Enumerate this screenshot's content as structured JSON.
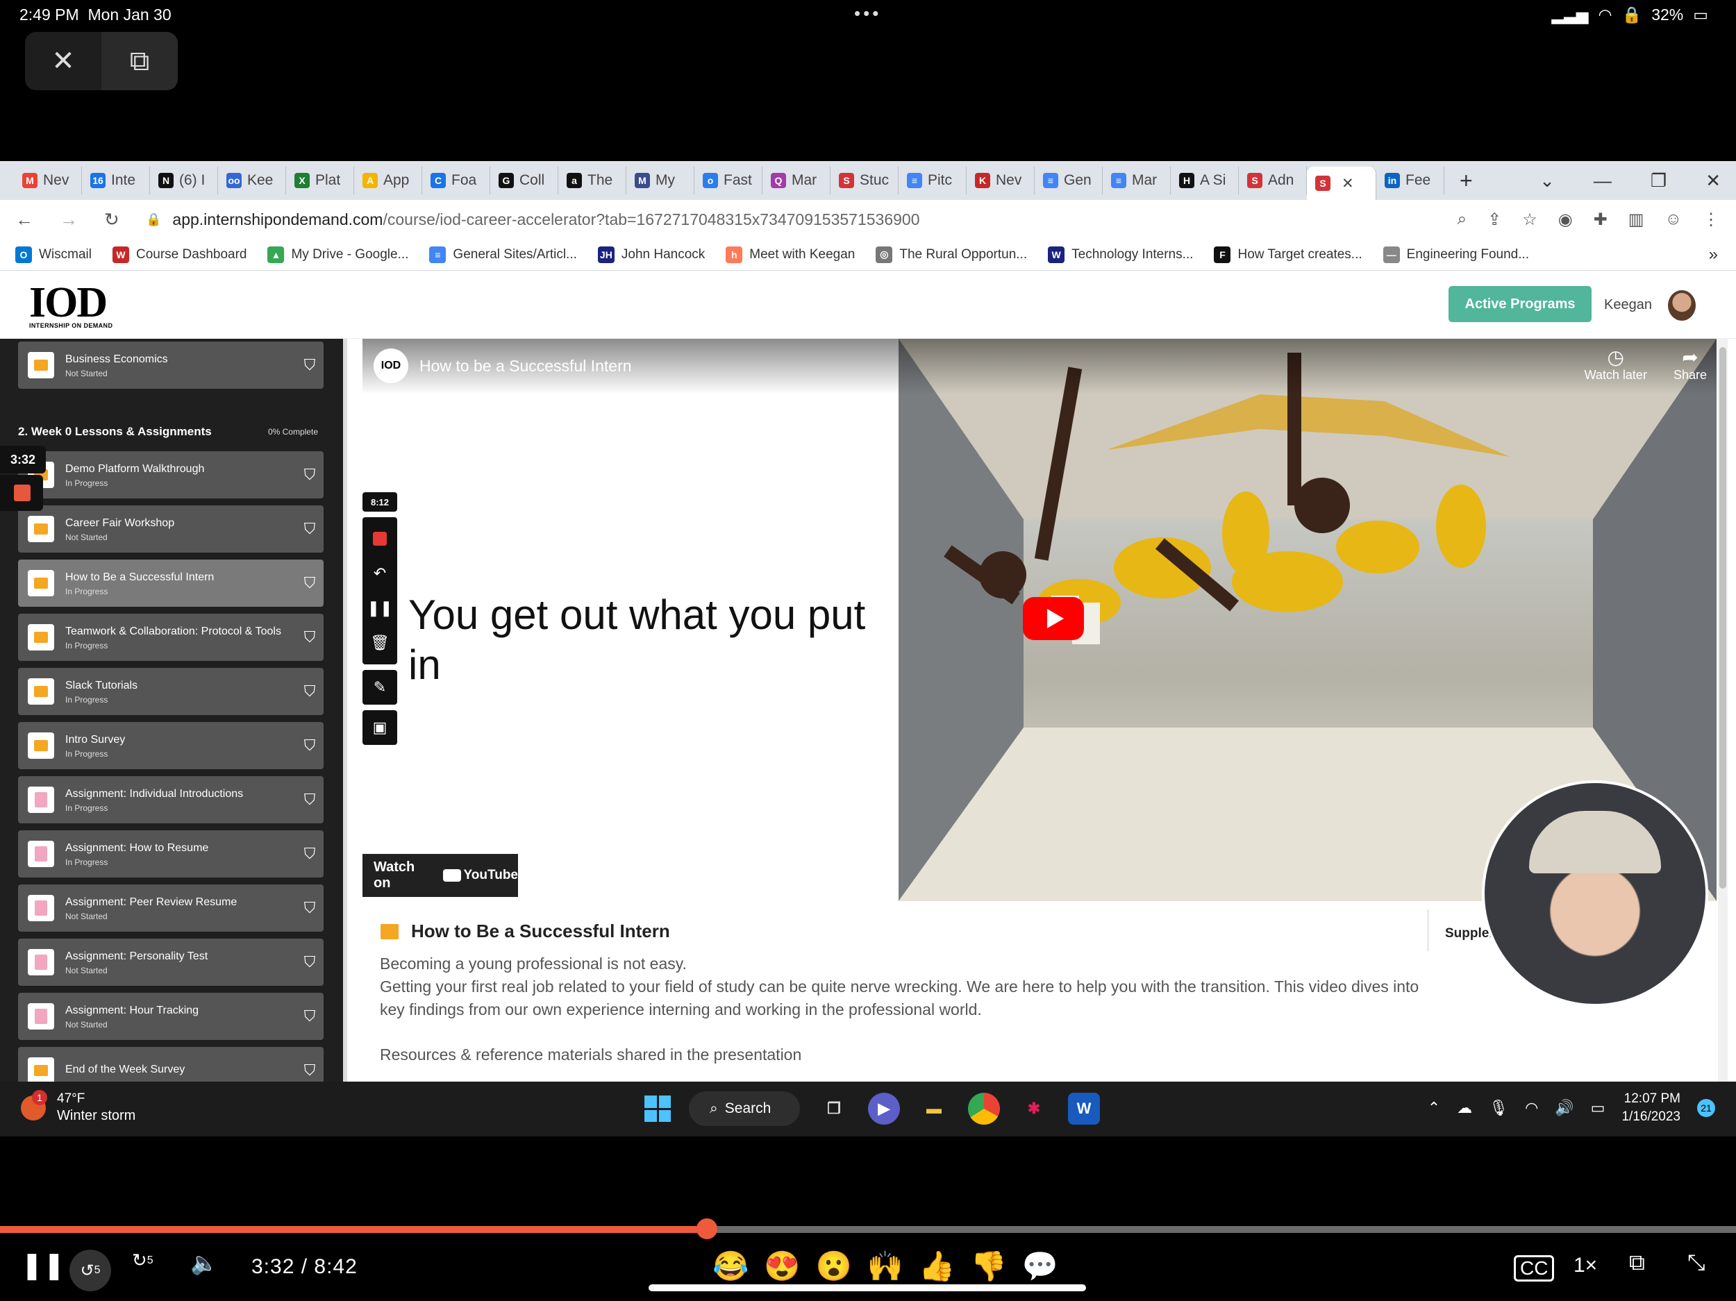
{
  "ios_status": {
    "time": "2:49 PM",
    "date": "Mon Jan 30",
    "battery": "32%"
  },
  "pip": {
    "close_icon": "close-icon",
    "restore_icon": "pip-restore-icon"
  },
  "browser": {
    "tabs": [
      {
        "label": "Nev",
        "color": "#ea4335",
        "glyph": "M"
      },
      {
        "label": "Inte",
        "color": "#1a73e8",
        "glyph": "16"
      },
      {
        "label": "(6) I",
        "color": "#111111",
        "glyph": "N"
      },
      {
        "label": "Kee",
        "color": "#3367d6",
        "glyph": "oo"
      },
      {
        "label": "Plat",
        "color": "#1e7e34",
        "glyph": "X"
      },
      {
        "label": "App",
        "color": "#f4b400",
        "glyph": "A"
      },
      {
        "label": "Foa",
        "color": "#1a73e8",
        "glyph": "C"
      },
      {
        "label": "Coll",
        "color": "#111111",
        "glyph": "G"
      },
      {
        "label": "The",
        "color": "#111111",
        "glyph": "a"
      },
      {
        "label": "My",
        "color": "#3b4b8c",
        "glyph": "M"
      },
      {
        "label": "Fast",
        "color": "#2b7de9",
        "glyph": "o"
      },
      {
        "label": "Mar",
        "color": "#a23aa8",
        "glyph": "Q"
      },
      {
        "label": "Stuc",
        "color": "#d13438",
        "glyph": "S"
      },
      {
        "label": "Pitc",
        "color": "#4285f4",
        "glyph": "≡"
      },
      {
        "label": "Nev",
        "color": "#c62828",
        "glyph": "K"
      },
      {
        "label": "Gen",
        "color": "#4285f4",
        "glyph": "≡"
      },
      {
        "label": "Mar",
        "color": "#4285f4",
        "glyph": "≡"
      },
      {
        "label": "A Si",
        "color": "#111111",
        "glyph": "H"
      },
      {
        "label": "Adn",
        "color": "#d13438",
        "glyph": "S"
      },
      {
        "label": "",
        "color": "#d13438",
        "glyph": "S",
        "active": true
      },
      {
        "label": "Fee",
        "color": "#0a66c2",
        "glyph": "in"
      }
    ],
    "url_domain": "app.internshipondemand.com",
    "url_path": "/course/iod-career-accelerator?tab=1672717048315x734709153571536900",
    "bookmarks": [
      {
        "label": "Wiscmail",
        "color": "#0078d4",
        "glyph": "O"
      },
      {
        "label": "Course Dashboard",
        "color": "#c62828",
        "glyph": "W"
      },
      {
        "label": "My Drive - Google...",
        "color": "#34a853",
        "glyph": "▲"
      },
      {
        "label": "General Sites/Articl...",
        "color": "#4285f4",
        "glyph": "≡"
      },
      {
        "label": "John Hancock",
        "color": "#1a237e",
        "glyph": "JH"
      },
      {
        "label": "Meet with Keegan",
        "color": "#ff7a59",
        "glyph": "h"
      },
      {
        "label": "The Rural Opportun...",
        "color": "#777777",
        "glyph": "◎"
      },
      {
        "label": "Technology Interns...",
        "color": "#1a237e",
        "glyph": "W"
      },
      {
        "label": "How Target creates...",
        "color": "#111111",
        "glyph": "F"
      },
      {
        "label": "Engineering Found...",
        "color": "#888888",
        "glyph": "—"
      }
    ]
  },
  "site": {
    "logo_text": "IOD",
    "logo_sub": "INTERNSHIP ON DEMAND",
    "active_programs": "Active Programs",
    "user_name": "Keegan"
  },
  "sidebar": {
    "top_item": {
      "title": "Business Economics",
      "status": "Not Started"
    },
    "section": {
      "title": "2. Week 0 Lessons & Assignments",
      "progress": "0% Complete"
    },
    "timer": "3:32",
    "lessons": [
      {
        "title": "Demo Platform Walkthrough",
        "status": "In Progress",
        "type": "vid"
      },
      {
        "title": "Career Fair Workshop",
        "status": "Not Started",
        "type": "vid"
      },
      {
        "title": "How to Be a Successful Intern",
        "status": "In Progress",
        "type": "vid",
        "selected": true
      },
      {
        "title": "Teamwork & Collaboration: Protocol & Tools",
        "status": "In Progress",
        "type": "vid"
      },
      {
        "title": "Slack Tutorials",
        "status": "In Progress",
        "type": "vid"
      },
      {
        "title": "Intro Survey",
        "status": "In Progress",
        "type": "vid"
      },
      {
        "title": "Assignment: Individual Introductions",
        "status": "In Progress",
        "type": "doc"
      },
      {
        "title": "Assignment: How to Resume",
        "status": "In Progress",
        "type": "doc"
      },
      {
        "title": "Assignment: Peer Review Resume",
        "status": "Not Started",
        "type": "doc"
      },
      {
        "title": "Assignment: Personality Test",
        "status": "Not Started",
        "type": "doc"
      },
      {
        "title": "Assignment: Hour Tracking",
        "status": "Not Started",
        "type": "doc"
      },
      {
        "title": "End of the Week Survey",
        "status": "",
        "type": "vid"
      }
    ]
  },
  "video": {
    "title": "How to be a Successful Intern",
    "channel_logo": "IOD",
    "slide_text": "You get out what you put in",
    "watch_later": "Watch later",
    "share": "Share",
    "watch_on": "Watch on",
    "youtube": "YouTube",
    "rec_timer": "8:12"
  },
  "lesson": {
    "title": "How to Be a Successful Intern",
    "desc1": "Becoming a young professional is not easy.",
    "desc2": "Getting your first real job related to your field of study can be quite nerve wrecking. We are here to help you with the transition. This video dives into key findings from our own experience interning and working in the professional world.",
    "resources": "Resources & reference materials shared in the presentation",
    "supplemental": "Supplem"
  },
  "taskbar": {
    "temp": "47°F",
    "weather": "Winter storm",
    "weather_badge": "1",
    "search": "Search",
    "time": "12:07 PM",
    "date": "1/16/2023",
    "notif_count": "21"
  },
  "player": {
    "time": "3:32 / 8:42",
    "progress_fraction": 0.407,
    "skip_back": "5",
    "skip_fwd": "5",
    "speed": "1×",
    "emojis": [
      "😂",
      "😍",
      "😮",
      "🙌",
      "👍",
      "👎"
    ]
  }
}
